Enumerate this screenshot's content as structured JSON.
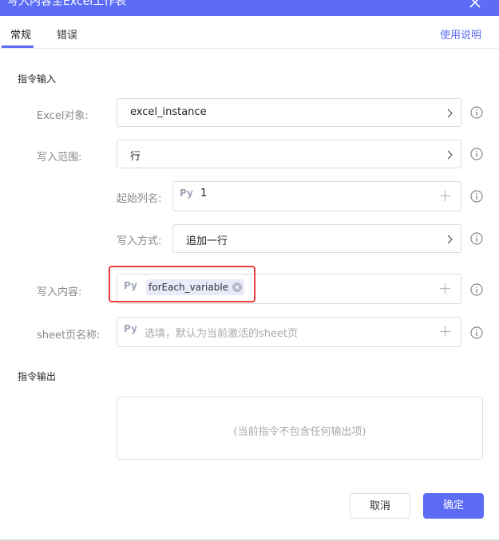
{
  "window": {
    "title": "写入内容至Excel工作表"
  },
  "tabs": [
    {
      "label": "常规"
    },
    {
      "label": "错误"
    }
  ],
  "help_label": "使用说明",
  "input_section": {
    "title": "指令输入"
  },
  "fields": {
    "excel_object": {
      "label": "Excel对象:",
      "value": "excel_instance"
    },
    "write_range": {
      "label": "写入范围:",
      "value": "行"
    },
    "start_column": {
      "label": "起始列名:",
      "prefix": "Py",
      "value": "1"
    },
    "write_mode": {
      "label": "写入方式:",
      "value": "追加一行"
    },
    "write_content": {
      "label": "写入内容:",
      "prefix": "Py",
      "chip": "forEach_variable"
    },
    "sheet_name": {
      "label": "sheet页名称:",
      "prefix": "Py",
      "placeholder": "选填，默认为当前激活的sheet页"
    }
  },
  "output_section": {
    "title": "指令输出",
    "empty_text": "(当前指令不包含任何输出项)"
  },
  "buttons": {
    "cancel": "取消",
    "ok": "确定"
  },
  "colors": {
    "accent": "#5c6cf5",
    "highlight": "#f03d3d"
  }
}
